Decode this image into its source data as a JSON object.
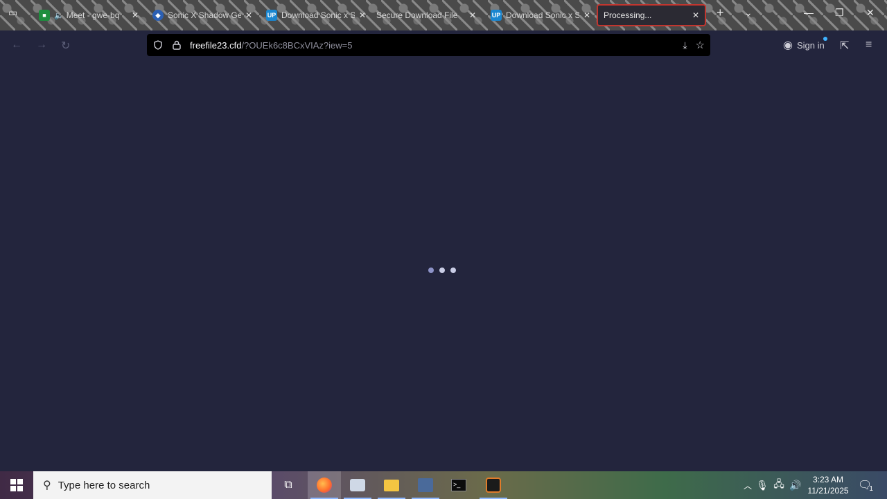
{
  "tabs": [
    {
      "label": "Meet - gwe-bq",
      "icon": "google-meet-icon",
      "muted_icon": "speaker-icon"
    },
    {
      "label": "Sonic X Shadow Ge",
      "icon": "shield-app-icon"
    },
    {
      "label": "Download Sonic x S",
      "icon": "upload-app-icon"
    },
    {
      "label": "Secure Download File",
      "icon": ""
    },
    {
      "label": "Download Sonic x S",
      "icon": "upload-app-icon"
    },
    {
      "label": "Processing...",
      "icon": "",
      "active": true
    }
  ],
  "url": {
    "domain": "freefile23.cfd",
    "path": "/?OUEk6c8BCxVIAz?iew=5"
  },
  "account": {
    "signin_label": "Sign in"
  },
  "taskbar": {
    "search_placeholder": "Type here to search"
  },
  "clock": {
    "time": "3:23 AM",
    "date": "11/21/2025"
  },
  "notifications": {
    "count": "1"
  },
  "colors": {
    "page_bg": "#23253d",
    "active_tab_border": "#c2362f",
    "url_bg": "#000000"
  }
}
